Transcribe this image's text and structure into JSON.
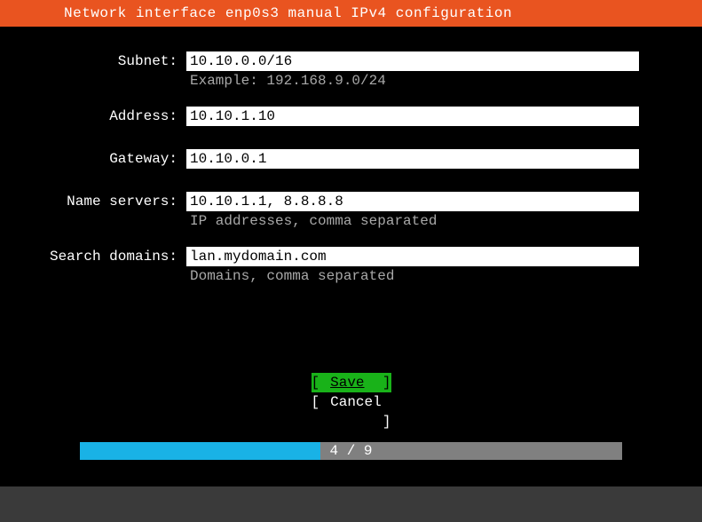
{
  "header": {
    "title": "Network interface enp0s3 manual IPv4 configuration"
  },
  "fields": {
    "subnet": {
      "label": "Subnet:",
      "value": "10.10.0.0/16",
      "hint": "Example: 192.168.9.0/24"
    },
    "address": {
      "label": "Address:",
      "value": "10.10.1.10",
      "hint": ""
    },
    "gateway": {
      "label": "Gateway:",
      "value": "10.10.0.1",
      "hint": ""
    },
    "dns": {
      "label": "Name servers:",
      "value": "10.10.1.1, 8.8.8.8",
      "hint": "IP addresses, comma separated"
    },
    "search": {
      "label": "Search domains:",
      "value": "lan.mydomain.com",
      "hint": "Domains, comma separated"
    }
  },
  "buttons": {
    "save": "Save",
    "cancel": "Cancel"
  },
  "progress": {
    "current": 4,
    "total": 9,
    "text": "4 / 9",
    "percent": 44.4
  },
  "colors": {
    "accent": "#e95420",
    "highlight": "#19b219",
    "progress": "#19b2e6"
  }
}
